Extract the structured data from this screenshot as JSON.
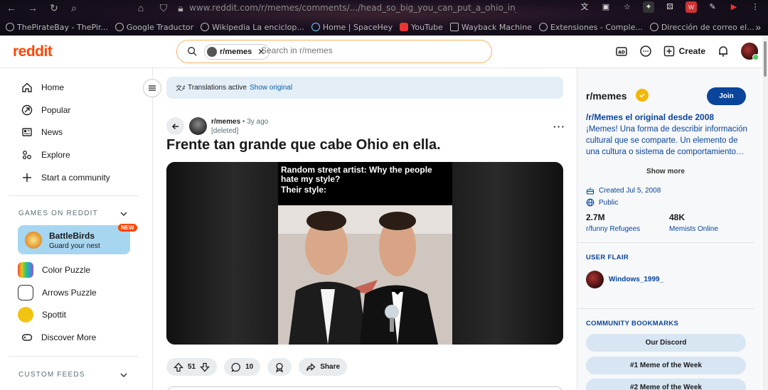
{
  "browser": {
    "url": "www.reddit.com/r/memes/comments/.../head_so_big_you_can_put_a_ohio_in_it/",
    "bookmarks": [
      {
        "label": "ThePirateBay - ThePir..."
      },
      {
        "label": "Google Traductor"
      },
      {
        "label": "Wikipedia La enciclop..."
      },
      {
        "label": "Home | SpaceHey"
      },
      {
        "label": "YouTube"
      },
      {
        "label": "Wayback Machine"
      },
      {
        "label": "Extensiones - Comple..."
      },
      {
        "label": "Dirección de correo el..."
      }
    ]
  },
  "header": {
    "logo": "reddit",
    "search_chip": "r/memes",
    "search_placeholder": "Search in r/memes",
    "create_label": "Create"
  },
  "leftnav": {
    "items": [
      {
        "label": "Home",
        "icon": "home-icon"
      },
      {
        "label": "Popular",
        "icon": "popular-icon"
      },
      {
        "label": "News",
        "icon": "news-icon"
      },
      {
        "label": "Explore",
        "icon": "explore-icon"
      },
      {
        "label": "Start a community",
        "icon": "plus-icon"
      }
    ],
    "games_title": "GAMES ON REDDIT",
    "featured_game": {
      "title": "BattleBirds",
      "subtitle": "Guard your nest",
      "badge": "NEW"
    },
    "games": [
      {
        "label": "Color Puzzle"
      },
      {
        "label": "Arrows Puzzle"
      },
      {
        "label": "Spottit"
      },
      {
        "label": "Discover More"
      }
    ],
    "custom_feeds_title": "CUSTOM FEEDS"
  },
  "post": {
    "translation_text": "Translations active",
    "translation_link": "Show original",
    "subreddit": "r/memes",
    "time": "3y ago",
    "author": "[deleted]",
    "title": "Frente tan grande que cabe Ohio en ella.",
    "meme_caption_1": "Random street artist: Why the people hate my style?",
    "meme_caption_2": "Their style:",
    "upvotes": "51",
    "comments": "10",
    "share_label": "Share"
  },
  "rightbar": {
    "title": "r/memes",
    "join_label": "Join",
    "tagline": "/r/Memes el original desde 2008",
    "description": "¡Memes! Una forma de describir información cultural que se comparte. Un elemento de una cultura o sistema de comportamiento…",
    "show_more": "Show more",
    "created": "Created Jul 5, 2008",
    "visibility": "Public",
    "members_count": "2.7M",
    "members_label": "r/funny Refugees",
    "online_count": "48K",
    "online_label": "Memists Online",
    "user_flair_title": "USER FLAIR",
    "flair_name": "Windows_1999_",
    "bookmarks_title": "COMMUNITY BOOKMARKS",
    "bookmarks": [
      {
        "label": "Our Discord"
      },
      {
        "label": "#1 Meme of the Week"
      },
      {
        "label": "#2 Meme of the Week"
      }
    ]
  },
  "colors": {
    "reddit_orange": "#ff4500",
    "link_blue": "#0a449b",
    "join_blue": "#0a449b",
    "battle_card": "#a7d6f0"
  }
}
